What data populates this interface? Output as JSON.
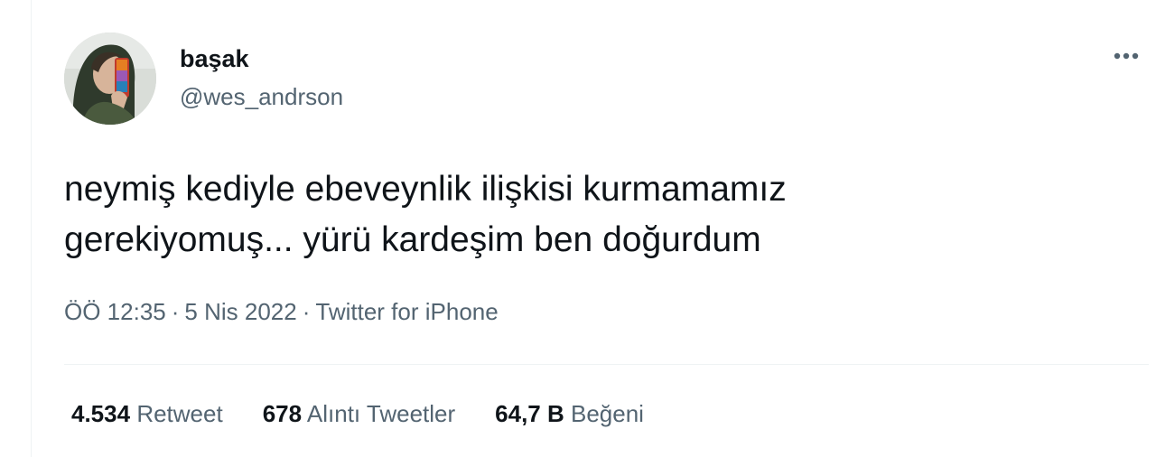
{
  "tweet": {
    "display_name": "başak",
    "handle": "@wes_andrson",
    "text": "neymiş kediyle ebeveynlik ilişkisi kurmamamız\ngerekiyomuş... yürü kardeşim ben doğurdum",
    "time": "ÖÖ 12:35",
    "date": "5 Nis 2022",
    "source": "Twitter for iPhone",
    "separator": "·",
    "more_icon": "more-horizontal-icon"
  },
  "stats": {
    "retweets": {
      "count": "4.534",
      "label": "Retweet"
    },
    "quotes": {
      "count": "678",
      "label": "Alıntı Tweetler"
    },
    "likes": {
      "count": "64,7 B",
      "label": "Beğeni"
    }
  },
  "colors": {
    "text": "#0f1419",
    "secondary": "#536471",
    "divider": "#eff3f4"
  }
}
